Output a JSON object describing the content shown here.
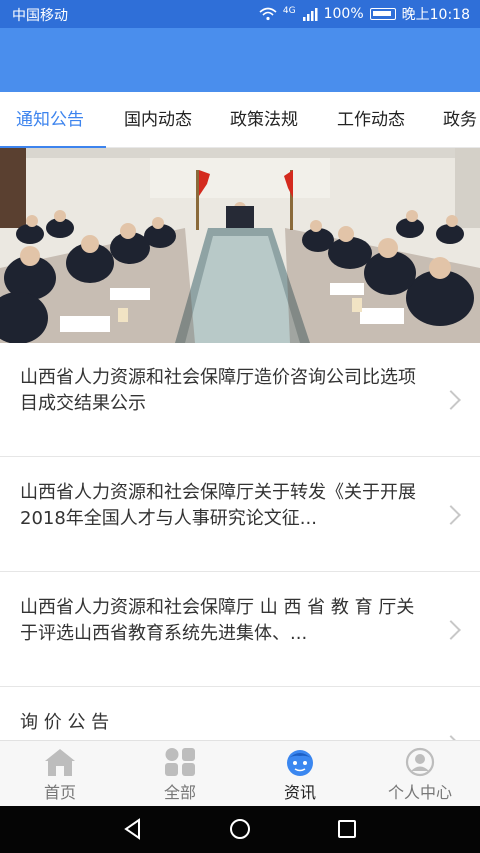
{
  "status_bar": {
    "carrier": "中国移动",
    "network": "4G",
    "battery": "100%",
    "time": "晚上10:18"
  },
  "tabs": [
    {
      "label": "通知公告",
      "active": true
    },
    {
      "label": "国内动态",
      "active": false
    },
    {
      "label": "政策法规",
      "active": false
    },
    {
      "label": "工作动态",
      "active": false
    },
    {
      "label": "政务",
      "active": false
    }
  ],
  "banner": {
    "slide_count": 3,
    "active_index": 0,
    "icon": "meeting-photo"
  },
  "news": [
    {
      "title": "山西省人力资源和社会保障厅造价咨询公司比选项目成交结果公示"
    },
    {
      "title": "山西省人力资源和社会保障厅关于转发《关于开展2018年全国人才与人事研究论文征..."
    },
    {
      "title": "山西省人力资源和社会保障厅 山 西 省 教 育 厅关于评选山西省教育系统先进集体、..."
    },
    {
      "title": "询 价 公 告"
    }
  ],
  "bottom_nav": [
    {
      "label": "首页",
      "icon": "home-icon",
      "active": false
    },
    {
      "label": "全部",
      "icon": "grid-icon",
      "active": false
    },
    {
      "label": "资讯",
      "icon": "news-face-icon",
      "active": true
    },
    {
      "label": "个人中心",
      "icon": "person-icon",
      "active": false
    }
  ],
  "colors": {
    "status_bar": "#2f6fd8",
    "header": "#4a8eed",
    "accent": "#3d84ee",
    "nav_active_icon": "#3b87f0"
  }
}
